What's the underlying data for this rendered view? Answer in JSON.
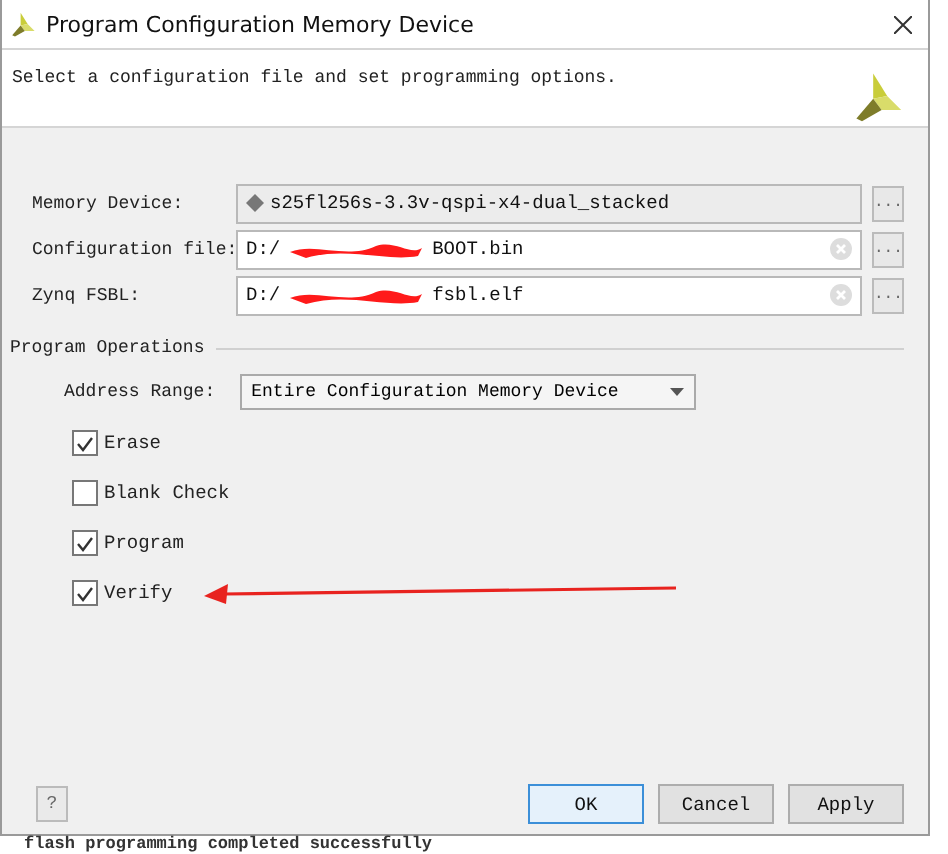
{
  "window": {
    "title": "Program Configuration Memory Device"
  },
  "header": {
    "description": "Select a configuration file and set programming options."
  },
  "fields": [
    {
      "label": "Memory Device:",
      "kind": "device",
      "value_start": "s25fl256s-3.3v-qspi-x4-dual_stacked",
      "button": "..."
    },
    {
      "label": "Configuration file:",
      "kind": "file",
      "value_start": "D:/",
      "value_end": "BOOT.bin",
      "redacted": true,
      "button": "..."
    },
    {
      "label": "Zynq FSBL:",
      "kind": "file",
      "value_start": "D:/",
      "value_end": "fsbl.elf",
      "redacted": true,
      "button": "..."
    }
  ],
  "program_operations": {
    "title": "Program Operations",
    "address_range": {
      "label": "Address Range:",
      "value": "Entire Configuration Memory Device"
    },
    "options": [
      {
        "label": "Erase",
        "checked": true
      },
      {
        "label": "Blank Check",
        "checked": false
      },
      {
        "label": "Program",
        "checked": true
      },
      {
        "label": "Verify",
        "checked": true
      }
    ]
  },
  "footer": {
    "help": "?",
    "buttons": [
      {
        "label": "OK",
        "default": true
      },
      {
        "label": "Cancel",
        "default": false
      },
      {
        "label": "Apply",
        "default": false
      }
    ]
  },
  "console": {
    "text": "flash programming completed successfully"
  }
}
